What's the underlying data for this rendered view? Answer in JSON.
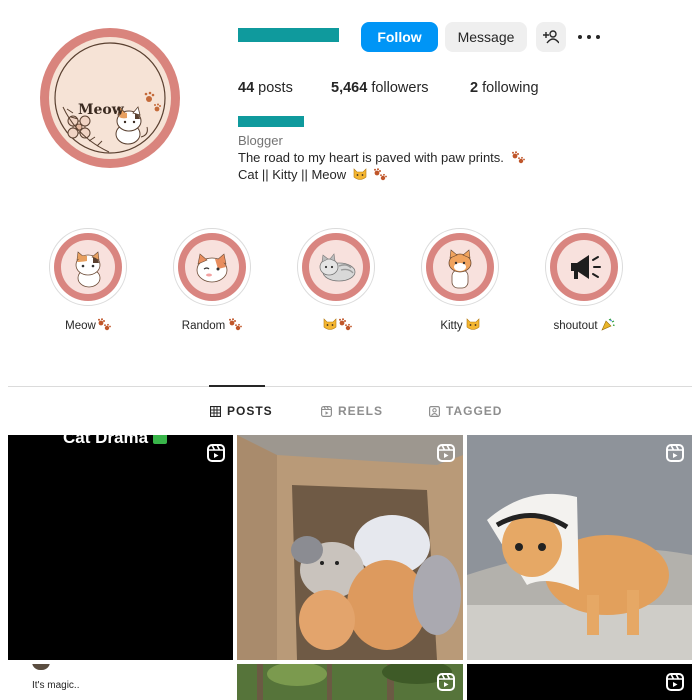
{
  "profile": {
    "avatar_text": "Meow",
    "category": "Blogger",
    "bio_line1": "The road to my heart is paved with paw prints.",
    "bio_line2": "Cat || Kitty || Meow",
    "redaction_color": "#0f9a9d"
  },
  "actions": {
    "follow_label": "Follow",
    "message_label": "Message",
    "suggest_icon": "person-add-icon",
    "more_icon": "more-options-icon"
  },
  "stats": {
    "posts_count": "44",
    "posts_label": "posts",
    "followers_count": "5,464",
    "followers_label": "followers",
    "following_count": "2",
    "following_label": "following"
  },
  "highlights": [
    {
      "label": "Meow",
      "icon": "calico-cat-icon"
    },
    {
      "label": "Random",
      "icon": "winking-cat-icon"
    },
    {
      "label": "",
      "icon": "grey-cat-icon"
    },
    {
      "label": "Kitty",
      "icon": "orange-cat-icon"
    },
    {
      "label": "shoutout",
      "icon": "megaphone-icon"
    }
  ],
  "tabs": [
    {
      "label": "POSTS",
      "icon": "grid-icon",
      "active": true
    },
    {
      "label": "REELS",
      "icon": "reels-icon",
      "active": false
    },
    {
      "label": "TAGGED",
      "icon": "tagged-icon",
      "active": false
    }
  ],
  "posts": [
    {
      "type": "reel",
      "caption": "Cat Drama"
    },
    {
      "type": "reel",
      "caption": ""
    },
    {
      "type": "reel",
      "caption": ""
    },
    {
      "type": "image",
      "caption": "It's magic.."
    },
    {
      "type": "reel",
      "caption": ""
    },
    {
      "type": "reel",
      "caption": ""
    }
  ],
  "colors": {
    "accent": "#0095f6",
    "highlight_ring": "#d98580",
    "avatar_ring": "#d9847d"
  }
}
